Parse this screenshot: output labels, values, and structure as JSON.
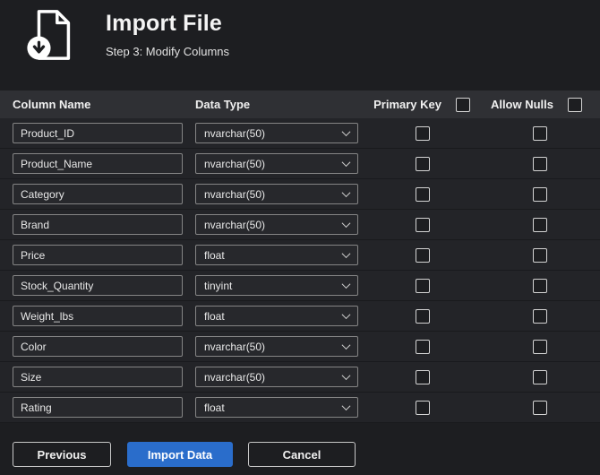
{
  "header": {
    "title": "Import File",
    "subtitle": "Step 3: Modify Columns"
  },
  "table": {
    "headers": {
      "column_name": "Column Name",
      "data_type": "Data Type",
      "primary_key": "Primary Key",
      "allow_nulls": "Allow Nulls"
    },
    "header_checkboxes": {
      "primary_key_all_checked": false,
      "allow_nulls_all_checked": false
    },
    "rows": [
      {
        "name": "Product_ID",
        "type": "nvarchar(50)",
        "primary_key": false,
        "allow_nulls": false
      },
      {
        "name": "Product_Name",
        "type": "nvarchar(50)",
        "primary_key": false,
        "allow_nulls": false
      },
      {
        "name": "Category",
        "type": "nvarchar(50)",
        "primary_key": false,
        "allow_nulls": false
      },
      {
        "name": "Brand",
        "type": "nvarchar(50)",
        "primary_key": false,
        "allow_nulls": false
      },
      {
        "name": "Price",
        "type": "float",
        "primary_key": false,
        "allow_nulls": false
      },
      {
        "name": "Stock_Quantity",
        "type": "tinyint",
        "primary_key": false,
        "allow_nulls": false
      },
      {
        "name": "Weight_lbs",
        "type": "float",
        "primary_key": false,
        "allow_nulls": false
      },
      {
        "name": "Color",
        "type": "nvarchar(50)",
        "primary_key": false,
        "allow_nulls": false
      },
      {
        "name": "Size",
        "type": "nvarchar(50)",
        "primary_key": false,
        "allow_nulls": false
      },
      {
        "name": "Rating",
        "type": "float",
        "primary_key": false,
        "allow_nulls": false
      }
    ]
  },
  "footer": {
    "previous_label": "Previous",
    "import_label": "Import Data",
    "cancel_label": "Cancel"
  },
  "colors": {
    "accent": "#2a6dcb"
  }
}
